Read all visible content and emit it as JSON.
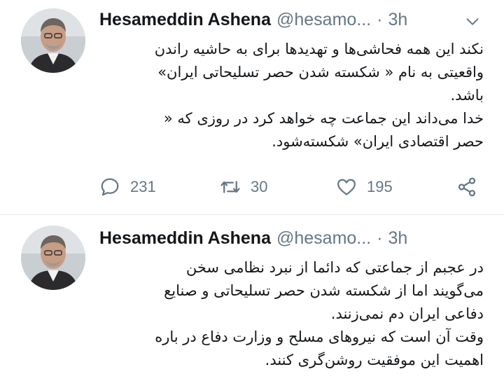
{
  "tweets": [
    {
      "author_name": "Hesameddin Ashena",
      "handle": "@hesamo...",
      "separator": "·",
      "time": "3h",
      "lines": [
        "نکند این همه فحاشی‌ها و تهدیدها برای به حاشیه راندن",
        "واقعیتی به نام « شکسته شدن حصر تسلیحاتی ایران»",
        "باشد.",
        "خدا می‌داند این جماعت چه خواهد کرد در روزی که «",
        "حصر اقتصادی ایران» شکسته‌شود."
      ],
      "replies": "231",
      "retweets": "30",
      "likes": "195"
    },
    {
      "author_name": "Hesameddin Ashena",
      "handle": "@hesamo...",
      "separator": "·",
      "time": "3h",
      "lines": [
        "در عجبم از جماعتی که دائما  از نبرد نظامی سخن",
        "می‌گویند اما از شکسته شدن حصر تسلیحاتی و صنایع",
        "دفاعی ایران دم نمی‌زنند.",
        "وقت آن است که نیروهای مسلح و وزارت دفاع در باره",
        "اهمیت این موفقیت روشن‌گری کنند."
      ]
    }
  ],
  "icons": {
    "reply": "reply-icon",
    "retweet": "retweet-icon",
    "like": "like-icon",
    "share": "share-icon",
    "caret": "chevron-down-icon"
  },
  "colors": {
    "text": "#14171a",
    "secondary": "#657786",
    "divider": "#e6ecf0"
  }
}
